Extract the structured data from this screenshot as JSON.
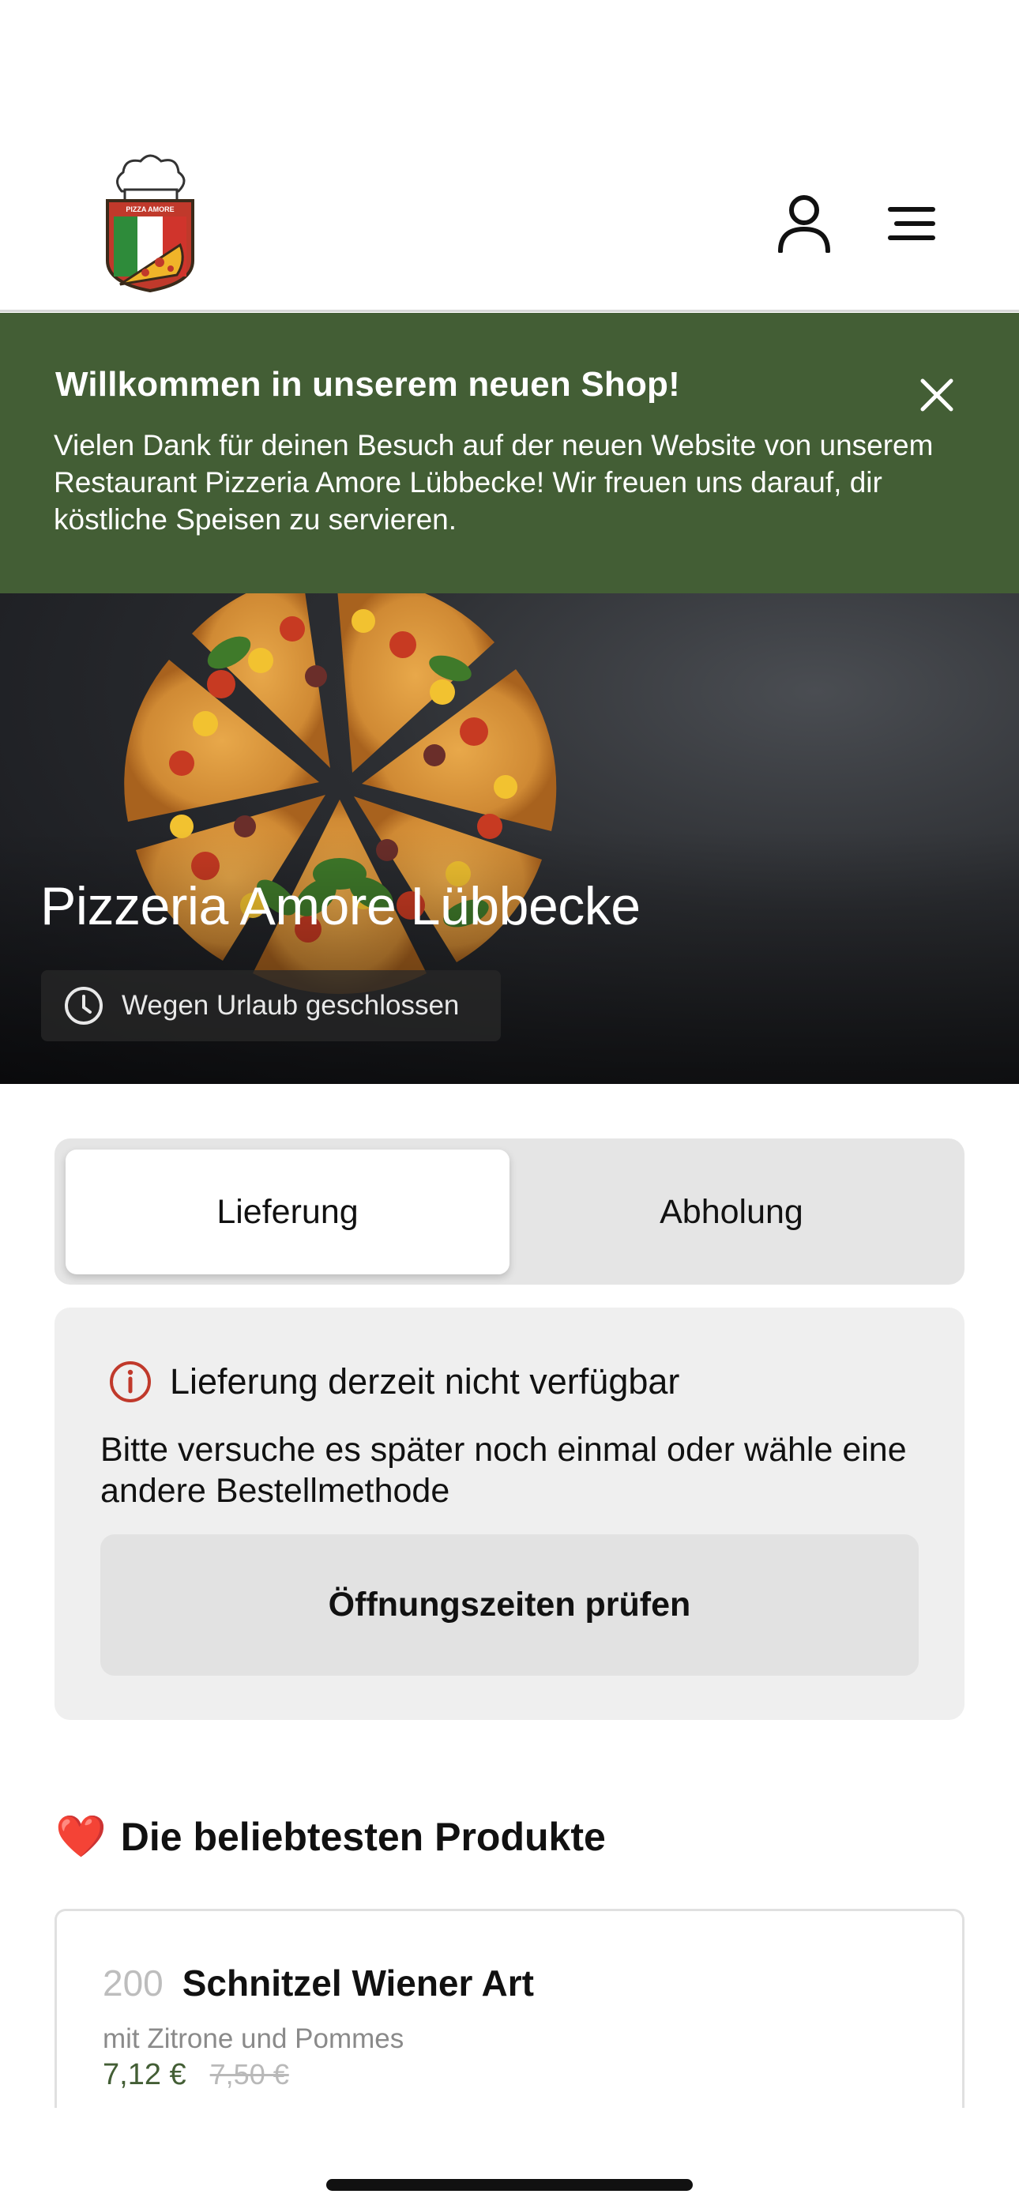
{
  "header": {
    "logo_text": "PIZZA AMORE",
    "account_icon": "person-icon",
    "menu_icon": "hamburger-menu-icon"
  },
  "banner": {
    "title": "Willkommen in unserem neuen Shop!",
    "text": "Vielen Dank für deinen Besuch auf der neuen Website von unserem Restaurant Pizzeria Amore Lübbecke! Wir freuen uns darauf, dir köstliche Speisen zu servieren.",
    "close_icon": "close-icon",
    "background": "#435e35"
  },
  "hero": {
    "title": "Pizzeria Amore Lübbecke",
    "status": "Wegen Urlaub geschlossen",
    "status_icon": "clock-icon"
  },
  "order_mode": {
    "options": [
      "Lieferung",
      "Abholung"
    ],
    "selected": "Lieferung"
  },
  "notice": {
    "icon": "info-icon",
    "title": "Lieferung derzeit nicht verfügbar",
    "text": "Bitte versuche es später noch einmal oder wähle eine andere Bestellmethode",
    "button": "Öffnungszeiten prüfen"
  },
  "popular": {
    "emoji": "❤️",
    "title": "Die beliebtesten Produkte",
    "products": [
      {
        "number": "200",
        "name": "Schnitzel Wiener Art",
        "description": "mit Zitrone und Pommes",
        "price": "7,12 €",
        "old_price": "7,50 €"
      }
    ]
  },
  "colors": {
    "accent_green": "#435e35",
    "alert_red": "#c0392b"
  }
}
